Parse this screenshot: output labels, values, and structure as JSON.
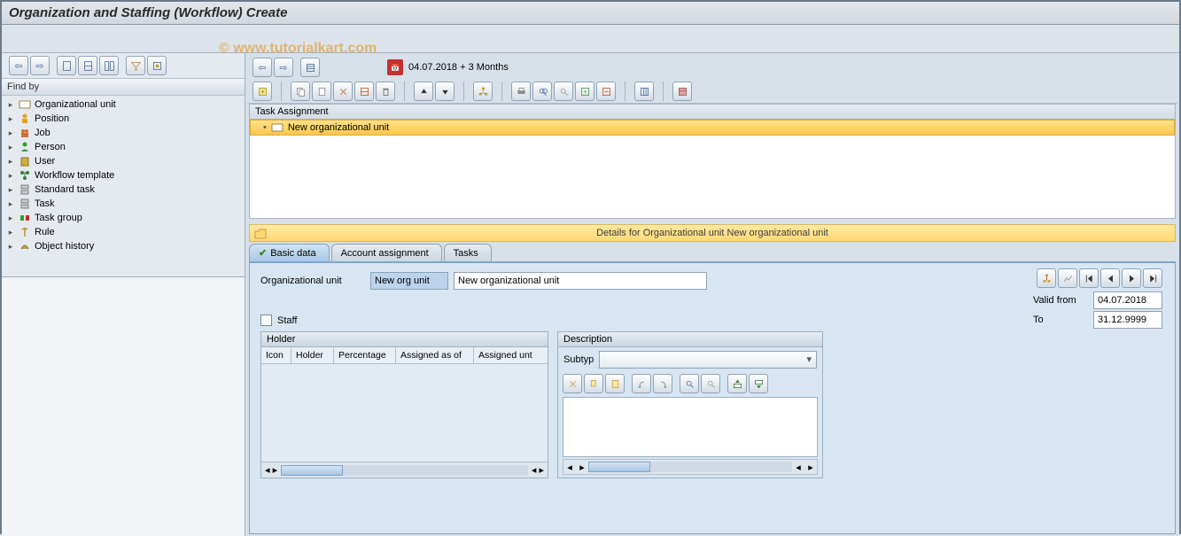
{
  "title": "Organization and Staffing (Workflow) Create",
  "watermark": "© www.tutorialkart.com",
  "findby": {
    "label": "Find by",
    "items": [
      {
        "label": "Organizational unit",
        "icon": "org-unit"
      },
      {
        "label": "Position",
        "icon": "position"
      },
      {
        "label": "Job",
        "icon": "job"
      },
      {
        "label": "Person",
        "icon": "person"
      },
      {
        "label": "User",
        "icon": "user"
      },
      {
        "label": "Workflow template",
        "icon": "workflow"
      },
      {
        "label": "Standard task",
        "icon": "std-task"
      },
      {
        "label": "Task",
        "icon": "task"
      },
      {
        "label": "Task group",
        "icon": "task-group"
      },
      {
        "label": "Rule",
        "icon": "rule"
      },
      {
        "label": "Object history",
        "icon": "history"
      }
    ]
  },
  "date_text": "04.07.2018  + 3 Months",
  "task_assignment": {
    "header": "Task Assignment",
    "selected": "New organizational unit"
  },
  "details_bar": "Details for Organizational unit New organizational unit",
  "tabs": [
    {
      "label": "Basic data",
      "active": true,
      "check": true
    },
    {
      "label": "Account assignment",
      "active": false
    },
    {
      "label": "Tasks",
      "active": false
    }
  ],
  "form": {
    "org_unit_label": "Organizational unit",
    "short": "New org unit",
    "long": "New organizational unit",
    "valid_from_label": "Valid from",
    "valid_from": "04.07.2018",
    "to_label": "To",
    "to": "31.12.9999",
    "staff_label": "Staff"
  },
  "holder": {
    "title": "Holder",
    "cols": [
      "Icon",
      "Holder",
      "Percentage",
      "Assigned as of",
      "Assigned unt"
    ]
  },
  "description": {
    "title": "Description",
    "subtyp_label": "Subtyp"
  }
}
